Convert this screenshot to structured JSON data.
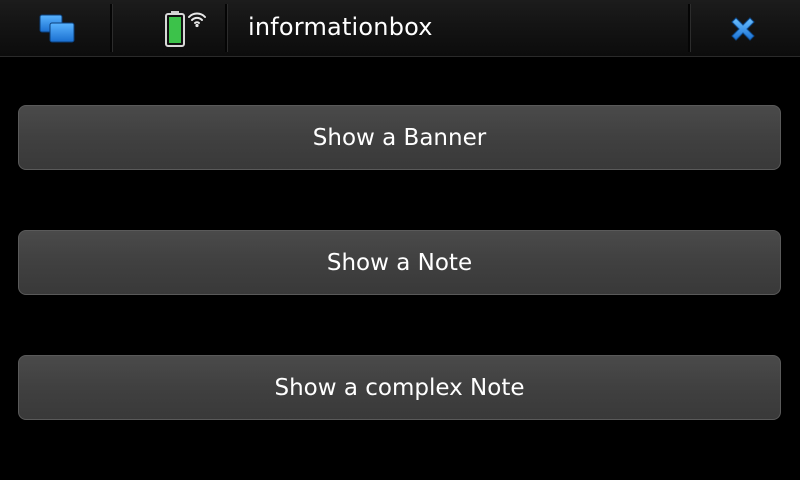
{
  "window": {
    "title": "informationbox"
  },
  "icons": {
    "task_switcher": "task-switcher-icon",
    "battery": "battery-icon",
    "wifi": "wifi-icon",
    "close": "close-icon"
  },
  "colors": {
    "accent_blue": "#2a8ee6",
    "battery_green": "#3cc24a",
    "background": "#000000",
    "button": "#434343"
  },
  "buttons": [
    {
      "label": "Show a Banner"
    },
    {
      "label": "Show a Note"
    },
    {
      "label": "Show a complex Note"
    }
  ]
}
